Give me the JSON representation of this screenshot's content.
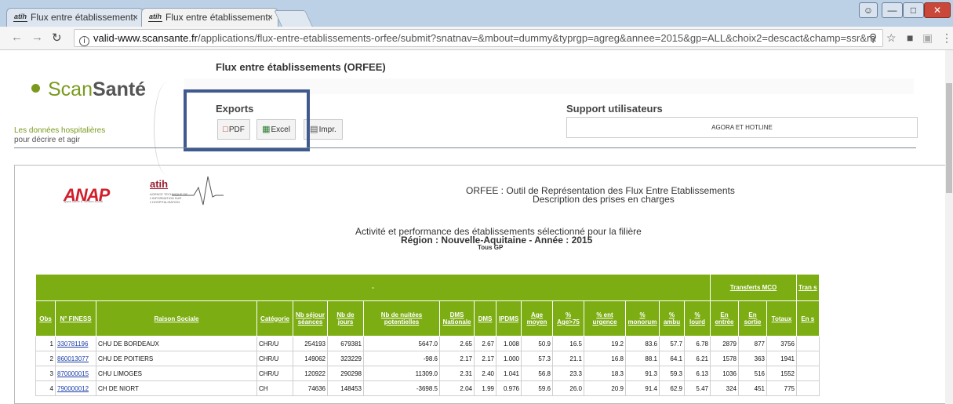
{
  "browser": {
    "tabs": [
      {
        "favicon": "atih",
        "title": "Flux entre établissement: ",
        "active": false
      },
      {
        "favicon": "atih",
        "title": "Flux entre établissement: ",
        "active": true
      }
    ],
    "tab_close": "×",
    "url_domain": "valid-www.scansante.fr",
    "url_path": "/applications/flux-entre-etablissements-orfee/submit?snatnav=&mbout=dummy&typrgp=agreg&annee=2015&gp=ALL&choix2=descact&champ=ssr&ra"
  },
  "header": {
    "page_title": "Flux entre établissements (ORFEE)",
    "logo_main": "Scan",
    "logo_bold": "Santé",
    "tagline_line1": "Les données hospitalières",
    "tagline_line2": "pour décrire et agir"
  },
  "exports": {
    "label": "Exports",
    "pdf": "PDF",
    "excel": "Excel",
    "print": "Impr."
  },
  "support": {
    "label": "Support utilisateurs",
    "agora": "AGORA ET HOTLINE"
  },
  "banner": {
    "anap": "ANAP",
    "anap_sub": "appui santé & médico-social",
    "atih": "atih",
    "atih_sub": "AGENCE TECHNIQUE DE L'INFORMATION SUR L'HOSPITALISATION",
    "orfee_line1": "ORFEE : Outil de Représentation des Flux Entre Etablissements",
    "orfee_line2": "Description des prises en charges"
  },
  "report": {
    "line1": "Activité et performance des établissements sélectionné pour la filière",
    "line2": "Région : Nouvelle-Aquitaine - Année : 2015",
    "line3": "Tous GP"
  },
  "table": {
    "group_headers": {
      "blank": "-",
      "transferts_mco": "Transferts MCO",
      "tran": "Tran s"
    },
    "columns": [
      "Obs",
      "N° FINESS",
      "Raison Sociale",
      "Catégorie",
      "Nb séjour séances",
      "Nb de jours",
      "Nb de nuitées potentielles",
      "DMS Nationale",
      "DMS",
      "IPDMS",
      "Age moyen",
      "% Age>75",
      "% ent urgence",
      "% monorum",
      "% ambu",
      "% lourd",
      "En entrée",
      "En sortie",
      "Totaux",
      "En s"
    ],
    "rows": [
      [
        "1",
        "330781196",
        "CHU DE BORDEAUX",
        "CHR/U",
        "254193",
        "679381",
        "5647.0",
        "2.65",
        "2.67",
        "1.008",
        "50.9",
        "16.5",
        "19.2",
        "83.6",
        "57.7",
        "6.78",
        "2879",
        "877",
        "3756",
        ""
      ],
      [
        "2",
        "860013077",
        "CHU DE POITIERS",
        "CHR/U",
        "149062",
        "323229",
        "-98.6",
        "2.17",
        "2.17",
        "1.000",
        "57.3",
        "21.1",
        "16.8",
        "88.1",
        "64.1",
        "6.21",
        "1578",
        "363",
        "1941",
        ""
      ],
      [
        "3",
        "870000015",
        "CHU LIMOGES",
        "CHR/U",
        "120922",
        "290298",
        "11309.0",
        "2.31",
        "2.40",
        "1.041",
        "56.8",
        "23.3",
        "18.3",
        "91.3",
        "59.3",
        "6.13",
        "1036",
        "516",
        "1552",
        ""
      ],
      [
        "4",
        "790000012",
        "CH DE NIORT",
        "CH",
        "74636",
        "148453",
        "-3698.5",
        "2.04",
        "1.99",
        "0.976",
        "59.6",
        "26.0",
        "20.9",
        "91.4",
        "62.9",
        "5.47",
        "324",
        "451",
        "775",
        ""
      ]
    ]
  }
}
